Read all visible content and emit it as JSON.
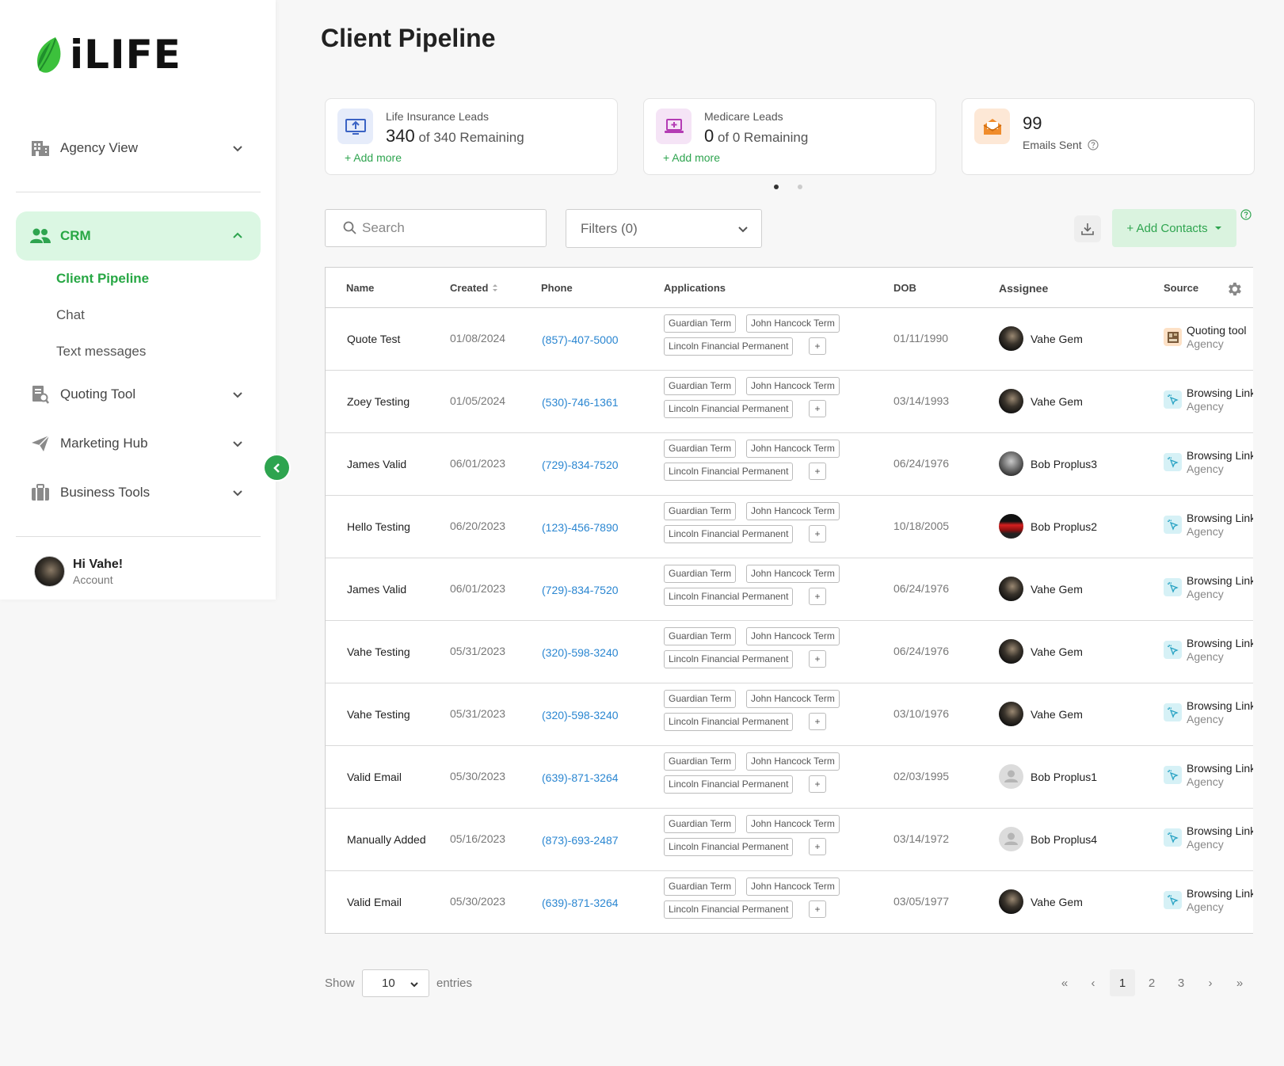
{
  "brand": {
    "name": "iLIFE",
    "accent": "#2ea44f",
    "accent_bg": "#dbf7e3"
  },
  "sidebar": {
    "items": [
      {
        "label": "Agency View",
        "icon": "building-icon"
      },
      {
        "label": "CRM",
        "icon": "users-icon"
      },
      {
        "label": "Quoting Tool",
        "icon": "document-search-icon"
      },
      {
        "label": "Marketing Hub",
        "icon": "paper-plane-icon"
      },
      {
        "label": "Business Tools",
        "icon": "briefcase-icon"
      }
    ],
    "crm_sub": [
      "Client Pipeline",
      "Chat",
      "Text messages"
    ],
    "user": {
      "greeting": "Hi Vahe!",
      "sub": "Account"
    }
  },
  "page": {
    "title": "Client Pipeline"
  },
  "cards": [
    {
      "label": "Life Insurance Leads",
      "value": "340",
      "suffix": " of 340 Remaining",
      "action": "+ Add more"
    },
    {
      "label": "Medicare Leads",
      "value": "0",
      "suffix": " of 0 Remaining",
      "action": "+ Add more"
    },
    {
      "label": "Emails Sent",
      "value": "99"
    }
  ],
  "toolbar": {
    "search_placeholder": "Search",
    "filters_label": "Filters (0)",
    "add_contacts_label": "+ Add Contacts"
  },
  "table": {
    "headers": {
      "name": "Name",
      "created": "Created",
      "phone": "Phone",
      "applications": "Applications",
      "dob": "DOB",
      "assignee": "Assignee",
      "source": "Source"
    },
    "tags": [
      "Guardian Term",
      "John Hancock Term",
      "Lincoln Financial Permanent",
      "+"
    ],
    "rows": [
      {
        "name": "Quote Test",
        "created": "01/08/2024",
        "phone": "(857)-407-5000",
        "dob": "01/11/1990",
        "assignee": "Vahe Gem",
        "source": "Quoting tool",
        "source_sub": "Agency"
      },
      {
        "name": "Zoey Testing",
        "created": "01/05/2024",
        "phone": "(530)-746-1361",
        "dob": "03/14/1993",
        "assignee": "Vahe Gem",
        "source": "Browsing Link",
        "source_sub": "Agency"
      },
      {
        "name": "James Valid",
        "created": "06/01/2023",
        "phone": "(729)-834-7520",
        "dob": "06/24/1976",
        "assignee": "Bob Proplus3",
        "source": "Browsing Link",
        "source_sub": "Agency"
      },
      {
        "name": "Hello Testing",
        "created": "06/20/2023",
        "phone": "(123)-456-7890",
        "dob": "10/18/2005",
        "assignee": "Bob Proplus2",
        "source": "Browsing Link",
        "source_sub": "Agency"
      },
      {
        "name": "James Valid",
        "created": "06/01/2023",
        "phone": "(729)-834-7520",
        "dob": "06/24/1976",
        "assignee": "Vahe Gem",
        "source": "Browsing Link",
        "source_sub": "Agency"
      },
      {
        "name": "Vahe Testing",
        "created": "05/31/2023",
        "phone": "(320)-598-3240",
        "dob": "06/24/1976",
        "assignee": "Vahe Gem",
        "source": "Browsing Link",
        "source_sub": "Agency"
      },
      {
        "name": "Vahe Testing",
        "created": "05/31/2023",
        "phone": "(320)-598-3240",
        "dob": "03/10/1976",
        "assignee": "Vahe Gem",
        "source": "Browsing Link",
        "source_sub": "Agency"
      },
      {
        "name": "Valid Email",
        "created": "05/30/2023",
        "phone": "(639)-871-3264",
        "dob": "02/03/1995",
        "assignee": "Bob Proplus1",
        "source": "Browsing Link",
        "source_sub": "Agency"
      },
      {
        "name": "Manually Added",
        "created": "05/16/2023",
        "phone": "(873)-693-2487",
        "dob": "03/14/1972",
        "assignee": "Bob Proplus4",
        "source": "Browsing Link",
        "source_sub": "Agency"
      },
      {
        "name": "Valid Email",
        "created": "05/30/2023",
        "phone": "(639)-871-3264",
        "dob": "03/05/1977",
        "assignee": "Vahe Gem",
        "source": "Browsing Link",
        "source_sub": "Agency"
      }
    ]
  },
  "pagination": {
    "show_label": "Show",
    "page_size": "10",
    "entries_label": "entries",
    "first": "«",
    "prev": "‹",
    "pages": [
      "1",
      "2",
      "3"
    ],
    "next": "›",
    "last": "»"
  }
}
